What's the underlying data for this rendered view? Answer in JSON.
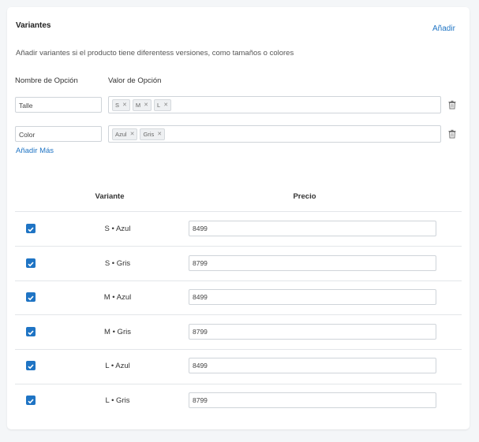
{
  "section": {
    "title": "Variantes",
    "add_label": "Añadir",
    "description": "Añadir variantes si el producto tiene diferentess versiones, como tamaños o colores"
  },
  "options_header": {
    "name_label": "Nombre de Opción",
    "value_label": "Valor de Opción"
  },
  "options": [
    {
      "name": "Talle",
      "values": [
        "S",
        "M",
        "L"
      ]
    },
    {
      "name": "Color",
      "values": [
        "Azul",
        "Gris"
      ]
    }
  ],
  "add_more_label": "Añadir Más",
  "table": {
    "headers": {
      "variant": "Variante",
      "price": "Precio"
    },
    "rows": [
      {
        "checked": true,
        "variant": "S • Azul",
        "price": "8499"
      },
      {
        "checked": true,
        "variant": "S • Gris",
        "price": "8799"
      },
      {
        "checked": true,
        "variant": "M • Azul",
        "price": "8499"
      },
      {
        "checked": true,
        "variant": "M • Gris",
        "price": "8799"
      },
      {
        "checked": true,
        "variant": "L • Azul",
        "price": "8499"
      },
      {
        "checked": true,
        "variant": "L • Gris",
        "price": "8799"
      }
    ]
  },
  "icons": {
    "remove_tag": "close-icon",
    "delete_option": "trash-icon",
    "checkbox": "check-icon"
  },
  "colors": {
    "accent": "#1f74c4",
    "border": "#cfd4d9"
  }
}
